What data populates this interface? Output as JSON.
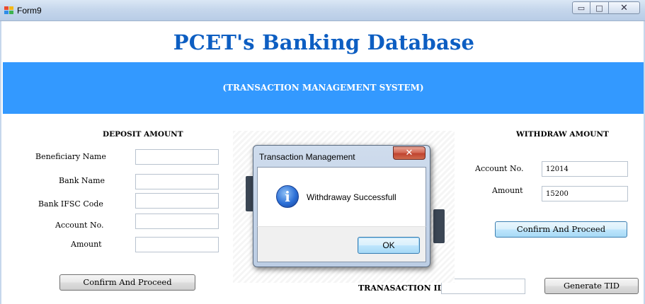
{
  "window": {
    "title": "Form9",
    "minimize_glyph": "▭",
    "maximize_glyph": "□",
    "close_glyph": "✕"
  },
  "header": {
    "title": "PCET's Banking Database",
    "subtitle": "(TRANSACTION MANAGEMENT SYSTEM)",
    "banner_color": "#3399ff",
    "title_color": "#0d5ec2"
  },
  "deposit": {
    "section_title": "DEPOSIT AMOUNT",
    "labels": {
      "beneficiary_name": "Beneficiary Name",
      "bank_name": "Bank Name",
      "bank_ifsc": "Bank IFSC Code",
      "account_no": "Account No.",
      "amount": "Amount"
    },
    "values": {
      "beneficiary_name": "",
      "bank_name": "",
      "bank_ifsc": "",
      "account_no": "",
      "amount": ""
    },
    "confirm_label": "Confirm And Proceed"
  },
  "withdraw": {
    "section_title": "WITHDRAW AMOUNT",
    "labels": {
      "account_no": "Account No.",
      "amount": "Amount"
    },
    "values": {
      "account_no": "12014",
      "amount": "15200"
    },
    "confirm_label": "Confirm And Proceed"
  },
  "transaction": {
    "tid_label": "TRANASACTION ID",
    "tid_value": "",
    "generate_label": "Generate TID"
  },
  "dialog": {
    "title": "Transaction Management",
    "close_glyph": "✕",
    "icon_glyph": "i",
    "message": "Withdraway Successfull",
    "ok_label": "OK"
  }
}
